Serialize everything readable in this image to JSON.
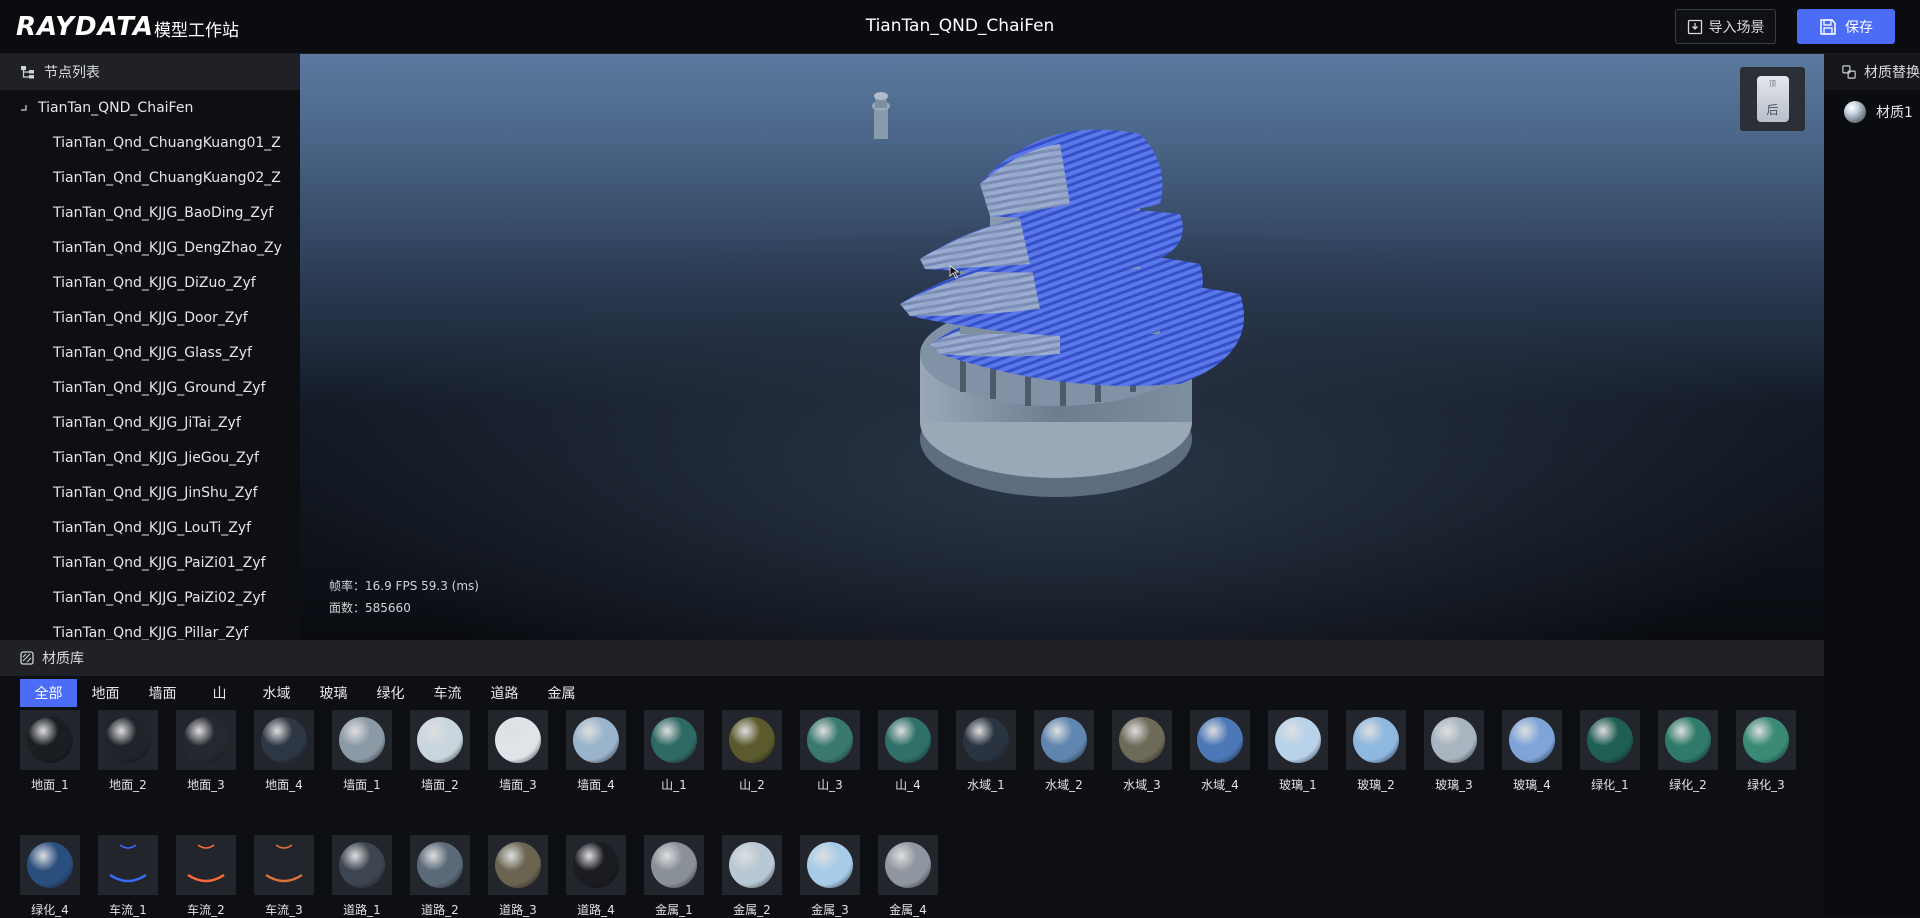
{
  "header": {
    "logo": "RAYDATA",
    "logo_sub": "模型工作站",
    "scene_title": "TianTan_QND_ChaiFen",
    "import_label": "导入场景",
    "save_label": "保存"
  },
  "node_panel": {
    "title": "节点列表",
    "root": "TianTan_QND_ChaiFen",
    "items": [
      "TianTan_Qnd_ChuangKuang01_Z",
      "TianTan_Qnd_ChuangKuang02_Z",
      "TianTan_Qnd_KJJG_BaoDing_Zyf",
      "TianTan_Qnd_KJJG_DengZhao_Zy",
      "TianTan_Qnd_KJJG_DiZuo_Zyf",
      "TianTan_Qnd_KJJG_Door_Zyf",
      "TianTan_Qnd_KJJG_Glass_Zyf",
      "TianTan_Qnd_KJJG_Ground_Zyf",
      "TianTan_Qnd_KJJG_JiTai_Zyf",
      "TianTan_Qnd_KJJG_JieGou_Zyf",
      "TianTan_Qnd_KJJG_JinShu_Zyf",
      "TianTan_Qnd_KJJG_LouTi_Zyf",
      "TianTan_Qnd_KJJG_PaiZi01_Zyf",
      "TianTan_Qnd_KJJG_PaiZi02_Zyf",
      "TianTan_Qnd_KJJG_Pillar_Zyf"
    ]
  },
  "viewport": {
    "fps_label": "帧率：",
    "fps_value": "16.9 FPS 59.3 (ms)",
    "faces_label": "面数：",
    "faces_value": "585660",
    "view_cube_face": "后",
    "view_cube_top": "顶"
  },
  "material_panel": {
    "title": "材质替换",
    "items": [
      "材质1"
    ]
  },
  "library": {
    "title": "材质库",
    "active_tab": "全部",
    "tabs": [
      "全部",
      "地面",
      "墙面",
      "山",
      "水域",
      "玻璃",
      "绿化",
      "车流",
      "道路",
      "金属"
    ],
    "materials": [
      {
        "name": "地面_1",
        "color": "#1a1d22"
      },
      {
        "name": "地面_2",
        "color": "#202329"
      },
      {
        "name": "地面_3",
        "color": "#25282e"
      },
      {
        "name": "地面_4",
        "color": "#2e3744"
      },
      {
        "name": "墙面_1",
        "color": "#8c9aa6"
      },
      {
        "name": "墙面_2",
        "color": "#c9d6de"
      },
      {
        "name": "墙面_3",
        "color": "#dfe4e8"
      },
      {
        "name": "墙面_4",
        "color": "#9ab4cc"
      },
      {
        "name": "山_1",
        "color": "#2e6a64"
      },
      {
        "name": "山_2",
        "color": "#5b5a2c"
      },
      {
        "name": "山_3",
        "color": "#3a7a6e"
      },
      {
        "name": "山_4",
        "color": "#2f7068"
      },
      {
        "name": "水域_1",
        "color": "#2a3440"
      },
      {
        "name": "水域_2",
        "color": "#5f86b0"
      },
      {
        "name": "水域_3",
        "color": "#6e6a58"
      },
      {
        "name": "水域_4",
        "color": "#4c78b8"
      },
      {
        "name": "玻璃_1",
        "color": "#b8d2ea"
      },
      {
        "name": "玻璃_2",
        "color": "#8fb8e0"
      },
      {
        "name": "玻璃_3",
        "color": "#a8b4bf"
      },
      {
        "name": "玻璃_4",
        "color": "#7ea4d8"
      },
      {
        "name": "绿化_1",
        "color": "#1f5e52"
      },
      {
        "name": "绿化_2",
        "color": "#2f7a68"
      },
      {
        "name": "绿化_3",
        "color": "#3a8a76"
      },
      {
        "name": "绿化_4",
        "color": "#2a4f7e"
      },
      {
        "name": "车流_1",
        "color": "#3b6bff"
      },
      {
        "name": "车流_2",
        "color": "#ff6a3b"
      },
      {
        "name": "车流_3",
        "color": "#e0703a"
      },
      {
        "name": "道路_1",
        "color": "#3d4650"
      },
      {
        "name": "道路_2",
        "color": "#5b6a78"
      },
      {
        "name": "道路_3",
        "color": "#6a6450"
      },
      {
        "name": "道路_4",
        "color": "#1a1c21"
      },
      {
        "name": "金属_1",
        "color": "#8a9098"
      },
      {
        "name": "金属_2",
        "color": "#b8c8d4"
      },
      {
        "name": "金属_3",
        "color": "#a8cce8"
      },
      {
        "name": "金属_4",
        "color": "#9096a0"
      }
    ]
  },
  "colors": {
    "accent": "#4a6cf7",
    "panel_bg": "#0e0f13",
    "panel_header": "#1f2126",
    "roof_blue": "#4a6cf7"
  }
}
